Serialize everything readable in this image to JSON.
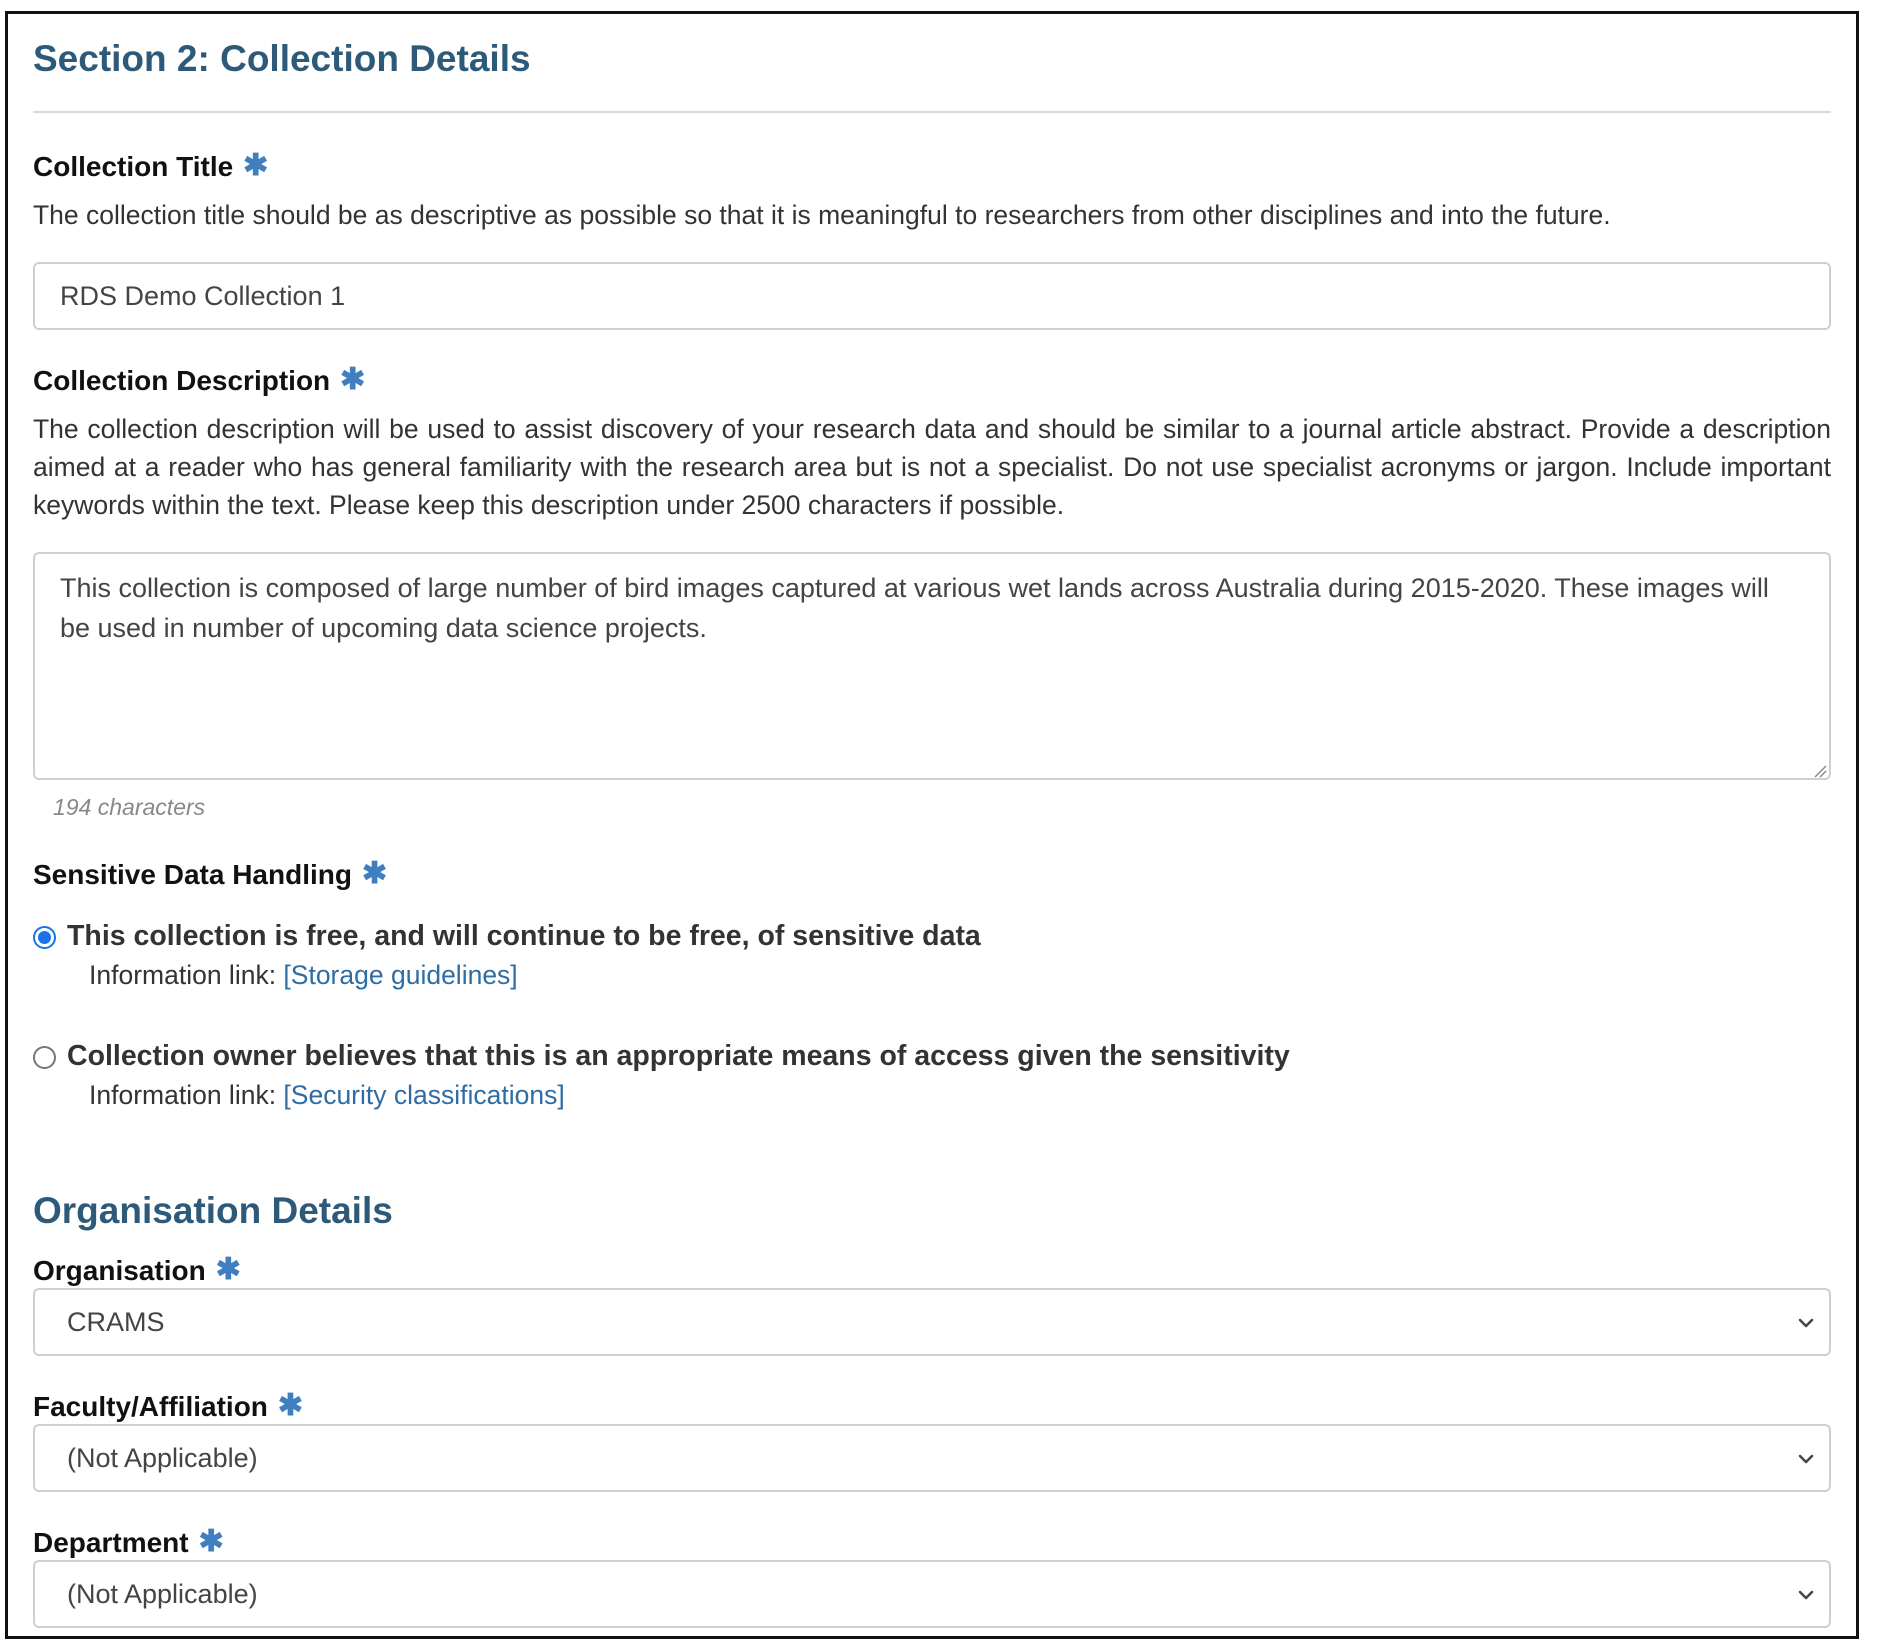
{
  "section": {
    "title": "Section 2: Collection Details"
  },
  "required_marker": "✱",
  "collection_title": {
    "label": "Collection Title",
    "help": "The collection title should be as descriptive as possible so that it is meaningful to researchers from other disciplines and into the future.",
    "value": "RDS Demo Collection 1"
  },
  "collection_description": {
    "label": "Collection Description",
    "help": "The collection description will be used to assist discovery of your research data and should be similar to a journal article abstract. Provide a description aimed at a reader who has general familiarity with the research area but is not a specialist. Do not use specialist acronyms or jargon. Include important keywords within the text. Please keep this description under 2500 characters if possible.",
    "value": "This collection is composed of large number of bird images captured at various wet lands across Australia during 2015-2020. These images will be used in number of upcoming data science projects.",
    "char_count": "194 characters"
  },
  "sensitive_data": {
    "label": "Sensitive Data Handling",
    "options": [
      {
        "label": "This collection is free, and will continue to be free, of sensitive data",
        "selected": true,
        "info_prefix": "Information link: ",
        "link_text": "[Storage guidelines]"
      },
      {
        "label": "Collection owner believes that this is an appropriate means of access given the sensitivity",
        "selected": false,
        "info_prefix": "Information link: ",
        "link_text": "[Security classifications]"
      }
    ]
  },
  "organisation_details": {
    "title": "Organisation Details",
    "organisation": {
      "label": "Organisation",
      "value": "CRAMS"
    },
    "faculty": {
      "label": "Faculty/Affiliation",
      "value": "(Not Applicable)"
    },
    "department": {
      "label": "Department",
      "value": "(Not Applicable)"
    }
  },
  "colors": {
    "heading": "#2d5a78",
    "required_star": "#3f7fc0",
    "link": "#2e6da4",
    "radio_selected": "#1a73e8"
  }
}
